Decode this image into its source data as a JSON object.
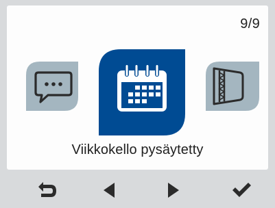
{
  "header": {
    "page_indicator": "9/9"
  },
  "carousel": {
    "items": [
      {
        "icon": "chat-bubble-icon",
        "state": "inactive"
      },
      {
        "icon": "calendar-icon",
        "state": "selected"
      },
      {
        "icon": "filter-icon",
        "state": "inactive"
      }
    ],
    "selected_label": "Viikkokello pysäytetty"
  },
  "footer": {
    "buttons": [
      {
        "icon": "back-arrow-icon",
        "action": "back"
      },
      {
        "icon": "triangle-left-icon",
        "action": "previous"
      },
      {
        "icon": "triangle-right-icon",
        "action": "next"
      },
      {
        "icon": "checkmark-icon",
        "action": "confirm"
      }
    ]
  },
  "colors": {
    "selected_tile": "#004b93",
    "inactive_tile": "#a4b6c0",
    "icon_dark": "#2b2b2b",
    "background": "#d8dadc",
    "panel": "#fdfdfd"
  }
}
